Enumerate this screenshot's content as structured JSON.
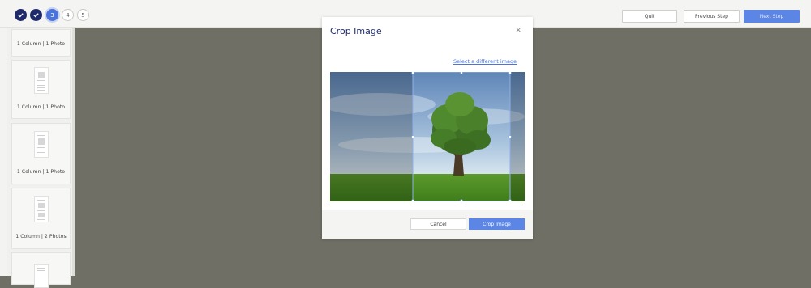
{
  "steps": [
    {
      "label": "",
      "state": "done",
      "icon": "check-icon"
    },
    {
      "label": "",
      "state": "done",
      "icon": "check-icon"
    },
    {
      "label": "3",
      "state": "current"
    },
    {
      "label": "4",
      "state": "future"
    },
    {
      "label": "5",
      "state": "future"
    }
  ],
  "toolbar": {
    "quit_label": "Quit",
    "previous_label": "Previous Step",
    "next_label": "Next Step"
  },
  "sidebar": {
    "items": [
      {
        "label": "1 Column | 1 Photo"
      },
      {
        "label": "1 Column | 1 Photo"
      },
      {
        "label": "1 Column | 1 Photo"
      },
      {
        "label": "1 Column | 2 Photos"
      }
    ]
  },
  "modal": {
    "title": "Crop Image",
    "close_glyph": "×",
    "different_link": "Select a different image",
    "cancel_label": "Cancel",
    "crop_label": "Crop Image"
  },
  "colors": {
    "navy": "#1f2a6b",
    "accent": "#5b86e6",
    "backdrop": "#6f6f66"
  }
}
